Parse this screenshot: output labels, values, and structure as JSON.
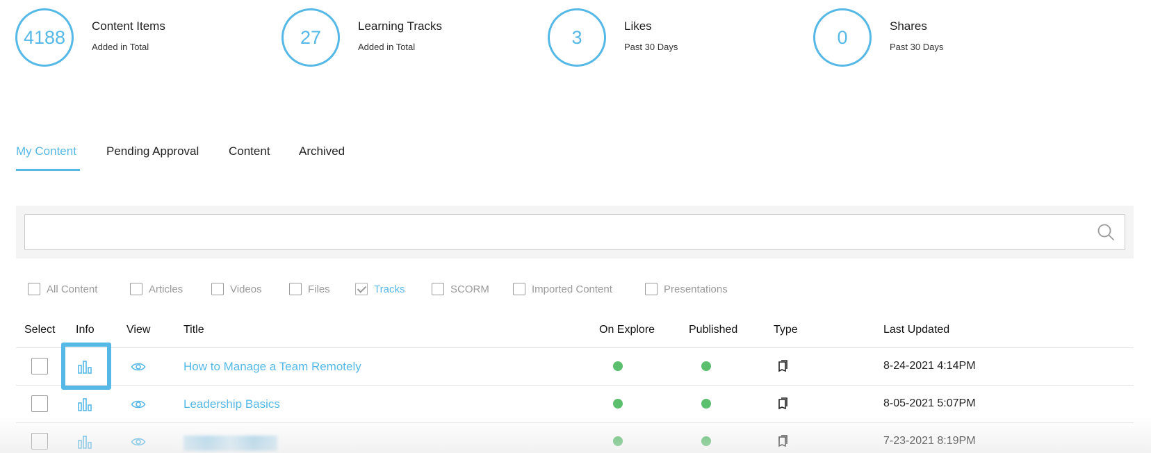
{
  "stats": [
    {
      "value": "4188",
      "title": "Content Items",
      "subtitle": "Added in Total"
    },
    {
      "value": "27",
      "title": "Learning Tracks",
      "subtitle": "Added in Total"
    },
    {
      "value": "3",
      "title": "Likes",
      "subtitle": "Past 30 Days"
    },
    {
      "value": "0",
      "title": "Shares",
      "subtitle": "Past 30 Days"
    }
  ],
  "tabs": [
    {
      "label": "My Content",
      "active": true
    },
    {
      "label": "Pending Approval",
      "active": false
    },
    {
      "label": "Content",
      "active": false
    },
    {
      "label": "Archived",
      "active": false
    }
  ],
  "search": {
    "value": "",
    "icon": "search-icon"
  },
  "filters": [
    {
      "label": "All Content",
      "checked": false
    },
    {
      "label": "Articles",
      "checked": false
    },
    {
      "label": "Videos",
      "checked": false
    },
    {
      "label": "Files",
      "checked": false
    },
    {
      "label": "Tracks",
      "checked": true
    },
    {
      "label": "SCORM",
      "checked": false
    },
    {
      "label": "Imported Content",
      "checked": false
    },
    {
      "label": "Presentations",
      "checked": false
    }
  ],
  "table": {
    "headers": {
      "select": "Select",
      "info": "Info",
      "view": "View",
      "title": "Title",
      "on_explore": "On Explore",
      "published": "Published",
      "type": "Type",
      "last_updated": "Last Updated"
    },
    "rows": [
      {
        "title": "How to Manage a Team Remotely",
        "on_explore": true,
        "published": true,
        "last_updated": "8-24-2021 4:14PM"
      },
      {
        "title": "Leadership Basics",
        "on_explore": true,
        "published": true,
        "last_updated": "8-05-2021 5:07PM"
      },
      {
        "title": "",
        "on_explore": true,
        "published": true,
        "last_updated": "7-23-2021 8:19PM"
      }
    ]
  },
  "colors": {
    "accent": "#55b8e6",
    "status_green": "#5cbf6e"
  }
}
